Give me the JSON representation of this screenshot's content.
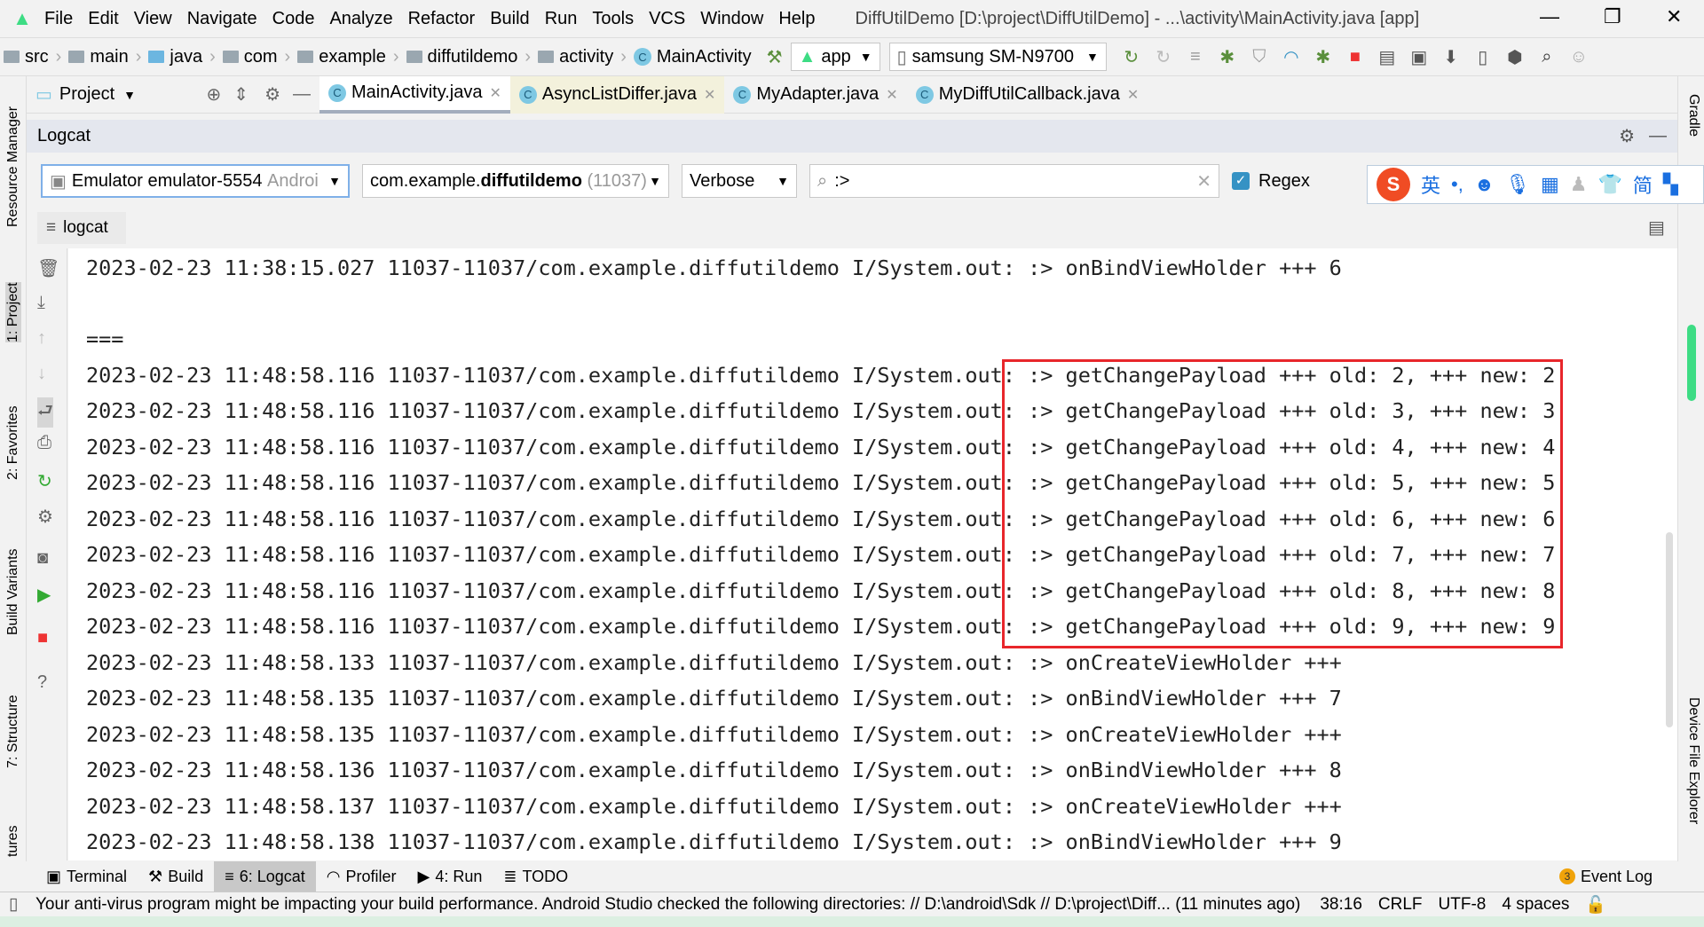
{
  "menu": {
    "items": [
      "File",
      "Edit",
      "View",
      "Navigate",
      "Code",
      "Analyze",
      "Refactor",
      "Build",
      "Run",
      "Tools",
      "VCS",
      "Window",
      "Help"
    ],
    "title": "DiffUtilDemo [D:\\project\\DiffUtilDemo] - ...\\activity\\MainActivity.java [app]"
  },
  "breadcrumb": [
    "src",
    "main",
    "java",
    "com",
    "example",
    "diffutildemo",
    "activity",
    "MainActivity"
  ],
  "toolbar": {
    "config": "app",
    "device": "samsung SM-N9700"
  },
  "project_panel": {
    "label": "Project"
  },
  "editor_tabs": [
    "MainActivity.java",
    "AsyncListDiffer.java",
    "MyAdapter.java",
    "MyDiffUtilCallback.java"
  ],
  "logcat": {
    "title": "Logcat",
    "device_prefix": "Emulator emulator-5554",
    "device_suffix": "Androi",
    "process_prefix": "com.example.",
    "process_bold": "diffutildemo",
    "process_pid": "(11037)",
    "level": "Verbose",
    "search": ":>",
    "regex_label": "Regex",
    "regex_checked": true,
    "tab": "logcat"
  },
  "log_lines": [
    "2023-02-23 11:38:15.027 11037-11037/com.example.diffutildemo I/System.out: :> onBindViewHolder +++ 6",
    "",
    "===",
    "2023-02-23 11:48:58.116 11037-11037/com.example.diffutildemo I/System.out: :> getChangePayload +++ old: 2, +++ new: 2",
    "2023-02-23 11:48:58.116 11037-11037/com.example.diffutildemo I/System.out: :> getChangePayload +++ old: 3, +++ new: 3",
    "2023-02-23 11:48:58.116 11037-11037/com.example.diffutildemo I/System.out: :> getChangePayload +++ old: 4, +++ new: 4",
    "2023-02-23 11:48:58.116 11037-11037/com.example.diffutildemo I/System.out: :> getChangePayload +++ old: 5, +++ new: 5",
    "2023-02-23 11:48:58.116 11037-11037/com.example.diffutildemo I/System.out: :> getChangePayload +++ old: 6, +++ new: 6",
    "2023-02-23 11:48:58.116 11037-11037/com.example.diffutildemo I/System.out: :> getChangePayload +++ old: 7, +++ new: 7",
    "2023-02-23 11:48:58.116 11037-11037/com.example.diffutildemo I/System.out: :> getChangePayload +++ old: 8, +++ new: 8",
    "2023-02-23 11:48:58.116 11037-11037/com.example.diffutildemo I/System.out: :> getChangePayload +++ old: 9, +++ new: 9",
    "2023-02-23 11:48:58.133 11037-11037/com.example.diffutildemo I/System.out: :> onCreateViewHolder +++",
    "2023-02-23 11:48:58.135 11037-11037/com.example.diffutildemo I/System.out: :> onBindViewHolder +++ 7",
    "2023-02-23 11:48:58.135 11037-11037/com.example.diffutildemo I/System.out: :> onCreateViewHolder +++",
    "2023-02-23 11:48:58.136 11037-11037/com.example.diffutildemo I/System.out: :> onBindViewHolder +++ 8",
    "2023-02-23 11:48:58.137 11037-11037/com.example.diffutildemo I/System.out: :> onCreateViewHolder +++",
    "2023-02-23 11:48:58.138 11037-11037/com.example.diffutildemo I/System.out: :> onBindViewHolder +++ 9"
  ],
  "left_stripe": [
    "Resource Manager",
    "1: Project",
    "2: Favorites",
    "Build Variants",
    "7: Structure",
    "tures"
  ],
  "right_stripe": [
    "Gradle",
    "Device File Explorer"
  ],
  "bottom_tools": [
    "Terminal",
    "Build",
    "6: Logcat",
    "Profiler",
    "4: Run",
    "TODO"
  ],
  "event_log": {
    "label": "Event Log",
    "count": "3"
  },
  "status": {
    "message": "Your anti-virus program might be impacting your build performance. Android Studio checked the following directories: // D:\\android\\Sdk // D:\\project\\Diff... (11 minutes ago)",
    "position": "38:16",
    "line_sep": "CRLF",
    "encoding": "UTF-8",
    "indent": "4 spaces"
  },
  "ime": {
    "lang": "英",
    "simplified": "简"
  },
  "colors": {
    "highlight_box": "#e8262b",
    "accent": "#3592c4"
  }
}
